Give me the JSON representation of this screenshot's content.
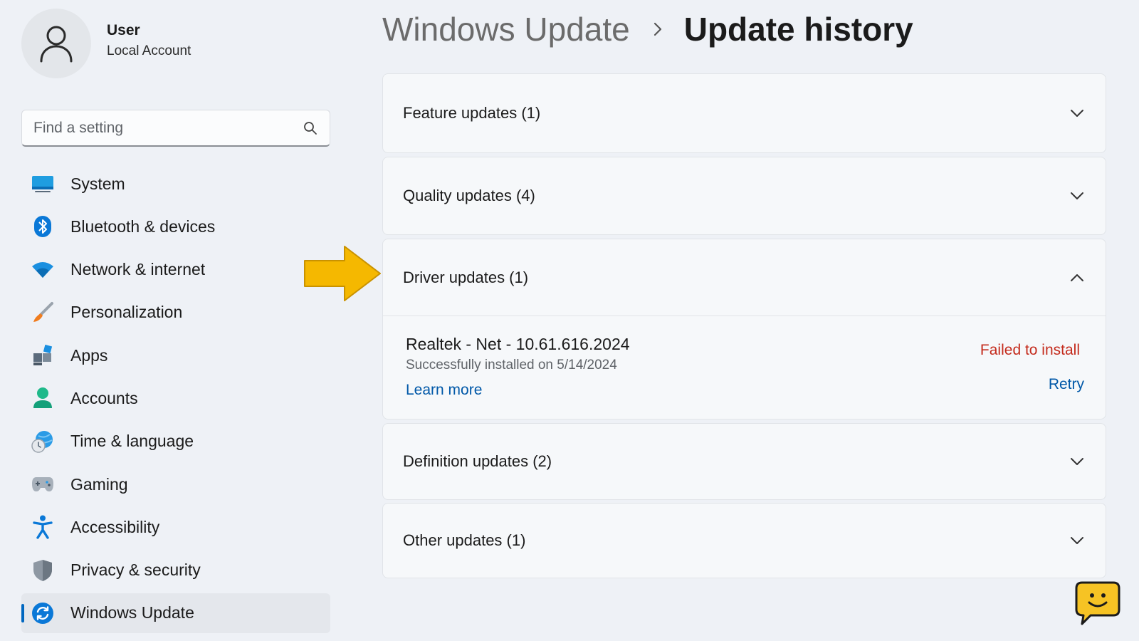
{
  "profile": {
    "name": "User",
    "account_type": "Local Account"
  },
  "search": {
    "placeholder": "Find a setting"
  },
  "sidebar": {
    "items": [
      {
        "label": "System",
        "icon": "system-icon",
        "active": false
      },
      {
        "label": "Bluetooth & devices",
        "icon": "bluetooth-icon",
        "active": false
      },
      {
        "label": "Network & internet",
        "icon": "wifi-icon",
        "active": false
      },
      {
        "label": "Personalization",
        "icon": "brush-icon",
        "active": false
      },
      {
        "label": "Apps",
        "icon": "apps-icon",
        "active": false
      },
      {
        "label": "Accounts",
        "icon": "person-icon",
        "active": false
      },
      {
        "label": "Time & language",
        "icon": "globe-clock-icon",
        "active": false
      },
      {
        "label": "Gaming",
        "icon": "gamepad-icon",
        "active": false
      },
      {
        "label": "Accessibility",
        "icon": "accessibility-icon",
        "active": false
      },
      {
        "label": "Privacy & security",
        "icon": "shield-icon",
        "active": false
      },
      {
        "label": "Windows Update",
        "icon": "sync-icon",
        "active": true
      }
    ]
  },
  "breadcrumb": {
    "parent": "Windows Update",
    "current": "Update history"
  },
  "sections": {
    "feature": {
      "title": "Feature updates (1)",
      "expanded": false
    },
    "quality": {
      "title": "Quality updates (4)",
      "expanded": false
    },
    "driver": {
      "title": "Driver updates (1)",
      "expanded": true
    },
    "definition": {
      "title": "Definition updates (2)",
      "expanded": false
    },
    "other": {
      "title": "Other updates (1)",
      "expanded": false
    }
  },
  "driver_update": {
    "name": "Realtek - Net - 10.61.616.2024",
    "date": "Successfully installed on 5/14/2024",
    "learn_more": "Learn more",
    "status": "Failed to install",
    "retry": "Retry"
  },
  "colors": {
    "accent": "#0067c0",
    "error": "#c42b1c",
    "link": "#0058a8",
    "annotation_arrow": "#f5b800"
  }
}
